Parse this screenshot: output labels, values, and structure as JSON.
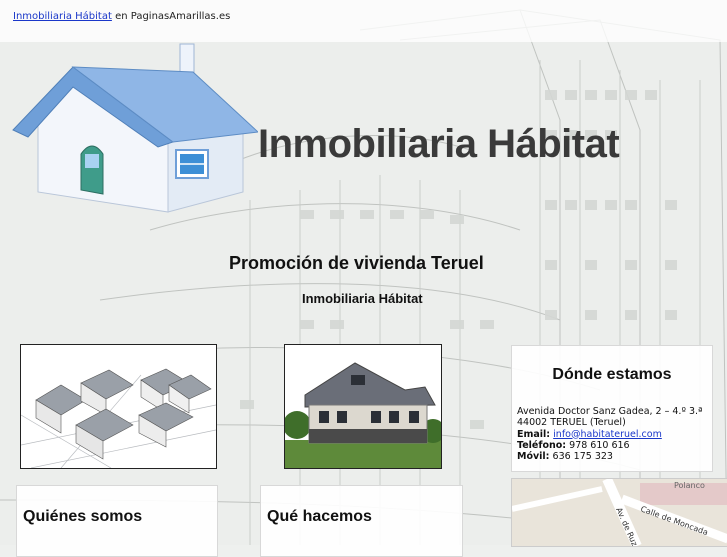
{
  "topbar": {
    "link_text": "Inmobiliaria Hábitat",
    "suffix_text": " en PaginasAmarillas.es"
  },
  "brand": {
    "title": "Inmobiliaria Hábitat"
  },
  "promo": {
    "heading": "Promoción de vivienda Teruel",
    "subheading": "Inmobiliaria Hábitat"
  },
  "contact": {
    "title": "Dónde estamos",
    "address_line1": "Avenida Doctor Sanz Gadea, 2 – 4.º 3.ª",
    "address_line2": "44002 TERUEL (Teruel)",
    "email_label": "Email:",
    "email": "info@habitateruel.com",
    "phone_label": "Teléfono:",
    "phone": "978 610 616",
    "mobile_label": "Móvil:",
    "mobile": "636 175 323"
  },
  "sections": {
    "quienes": "Quiénes somos",
    "que": "Qué hacemos"
  },
  "map": {
    "street1": "Av. de Ruz",
    "street2": "Calle de Moncada",
    "street3": "Polanco"
  },
  "colors": {
    "link": "#1a37c9",
    "brand_text": "#3a3a3a",
    "roof": "#6f9fd8"
  }
}
